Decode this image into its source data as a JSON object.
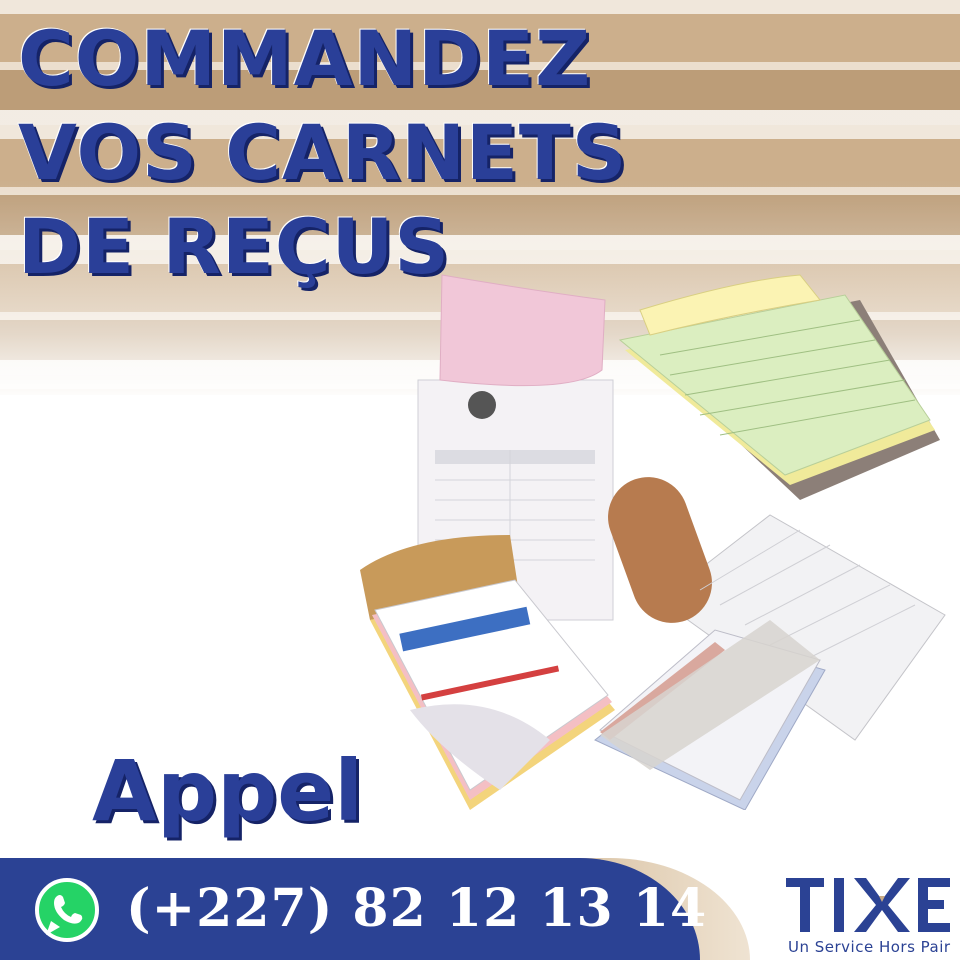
{
  "headline": {
    "line1": "COMMANDEZ",
    "line2": "VOS CARNETS",
    "line3": "DE REÇUS"
  },
  "call": {
    "label": "Appel",
    "phone": "(+227) 82 12 13 14",
    "icon": "whatsapp-icon"
  },
  "brand": {
    "name": "TIXE",
    "tagline": "Un Service Hors Pair"
  },
  "colors": {
    "primary": "#2b4294",
    "stripe": "#c9ab86"
  }
}
